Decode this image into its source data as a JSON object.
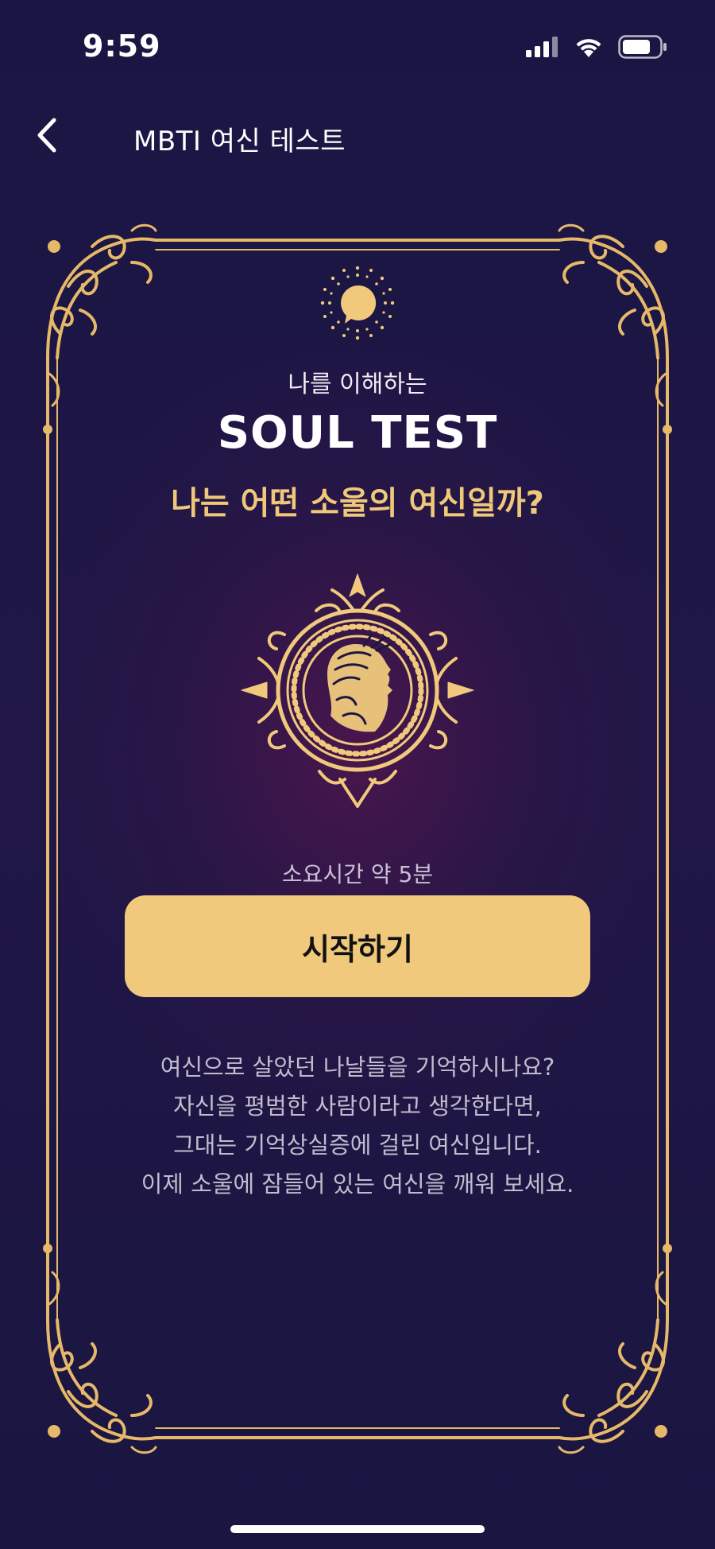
{
  "status_bar": {
    "time": "9:59",
    "icons": [
      "cellular-signal-icon",
      "wifi-icon",
      "battery-icon"
    ]
  },
  "nav": {
    "back_icon": "chevron-left-icon",
    "title": "MBTI 여신 테스트"
  },
  "hero": {
    "logo_icon": "sun-speech-bubble-logo",
    "subtitle": "나를 이해하는",
    "title": "SOUL TEST",
    "question": "나는 어떤 소울의 여신일까?",
    "emblem": "goddess-medallion-emblem"
  },
  "test": {
    "duration": "소요시간 약 5분",
    "start_label": "시작하기",
    "description_lines": [
      "여신으로 살았던 나날들을 기억하시나요?",
      "자신을 평범한 사람이라고 생각한다면,",
      "그대는 기억상실증에 걸린 여신입니다.",
      "이제 소울에 잠들어 있는 여신을 깨워 보세요."
    ]
  },
  "colors": {
    "background": "#1a1541",
    "accent_gold": "#f0c97c",
    "question_gold": "#f0c87a",
    "text_muted": "#c2bccd"
  }
}
